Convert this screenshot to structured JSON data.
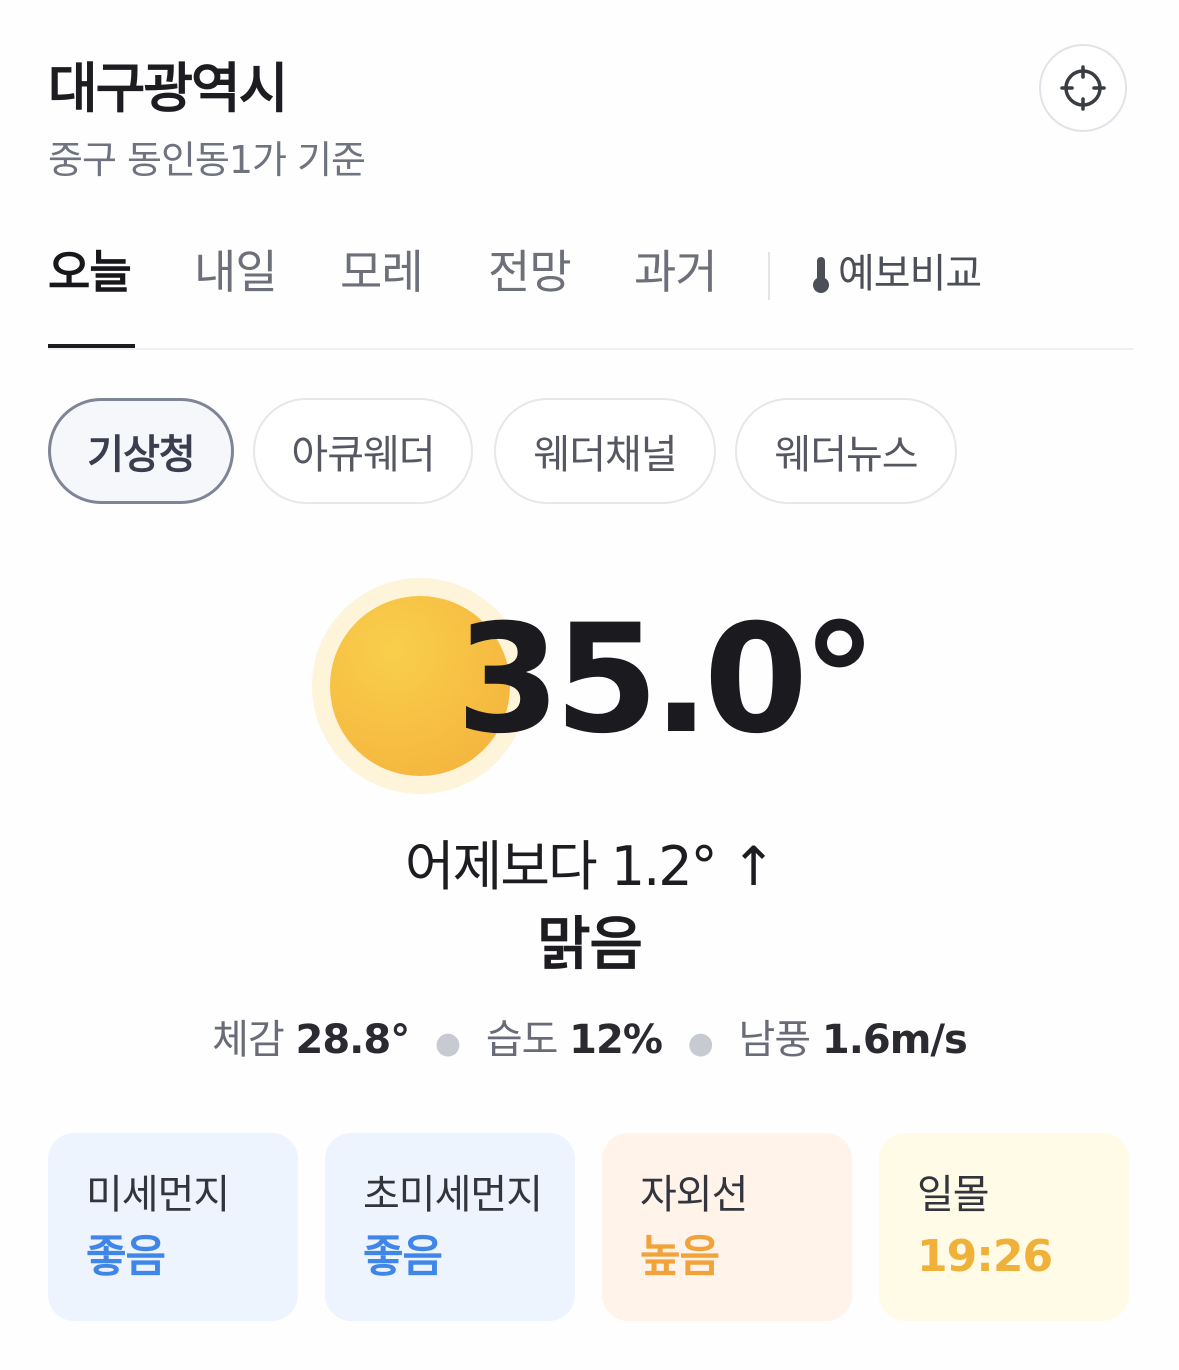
{
  "header": {
    "title": "대구광역시",
    "subtitle": "중구 동인동1가 기준"
  },
  "tabs": [
    {
      "label": "오늘",
      "active": true
    },
    {
      "label": "내일",
      "active": false
    },
    {
      "label": "모레",
      "active": false
    },
    {
      "label": "전망",
      "active": false
    },
    {
      "label": "과거",
      "active": false
    }
  ],
  "compare_tab": {
    "label": "예보비교",
    "icon": "thermometer-icon"
  },
  "sources": [
    {
      "label": "기상청",
      "active": true
    },
    {
      "label": "아큐웨더",
      "active": false
    },
    {
      "label": "웨더채널",
      "active": false
    },
    {
      "label": "웨더뉴스",
      "active": false
    }
  ],
  "current": {
    "icon": "sun-icon",
    "temperature": "35.0°",
    "comparison": "어제보다 1.2° ↑",
    "condition": "맑음",
    "feels_label": "체감",
    "feels_value": "28.8°",
    "humidity_label": "습도",
    "humidity_value": "12%",
    "wind_label": "남풍",
    "wind_value": "1.6m/s"
  },
  "cards": [
    {
      "label": "미세먼지",
      "value": "좋음",
      "bg": "#eef4fd",
      "color": "#3f86e8"
    },
    {
      "label": "초미세먼지",
      "value": "좋음",
      "bg": "#eef4fd",
      "color": "#3f86e8"
    },
    {
      "label": "자외선",
      "value": "높음",
      "bg": "#fff3ea",
      "color": "#f2a23a"
    },
    {
      "label": "일몰",
      "value": "19:26",
      "bg": "#fffbe6",
      "color": "#f0b13a"
    }
  ],
  "colors": {
    "accent": "#f5b73f",
    "text": "#1c1c21",
    "muted": "#6f7380"
  }
}
